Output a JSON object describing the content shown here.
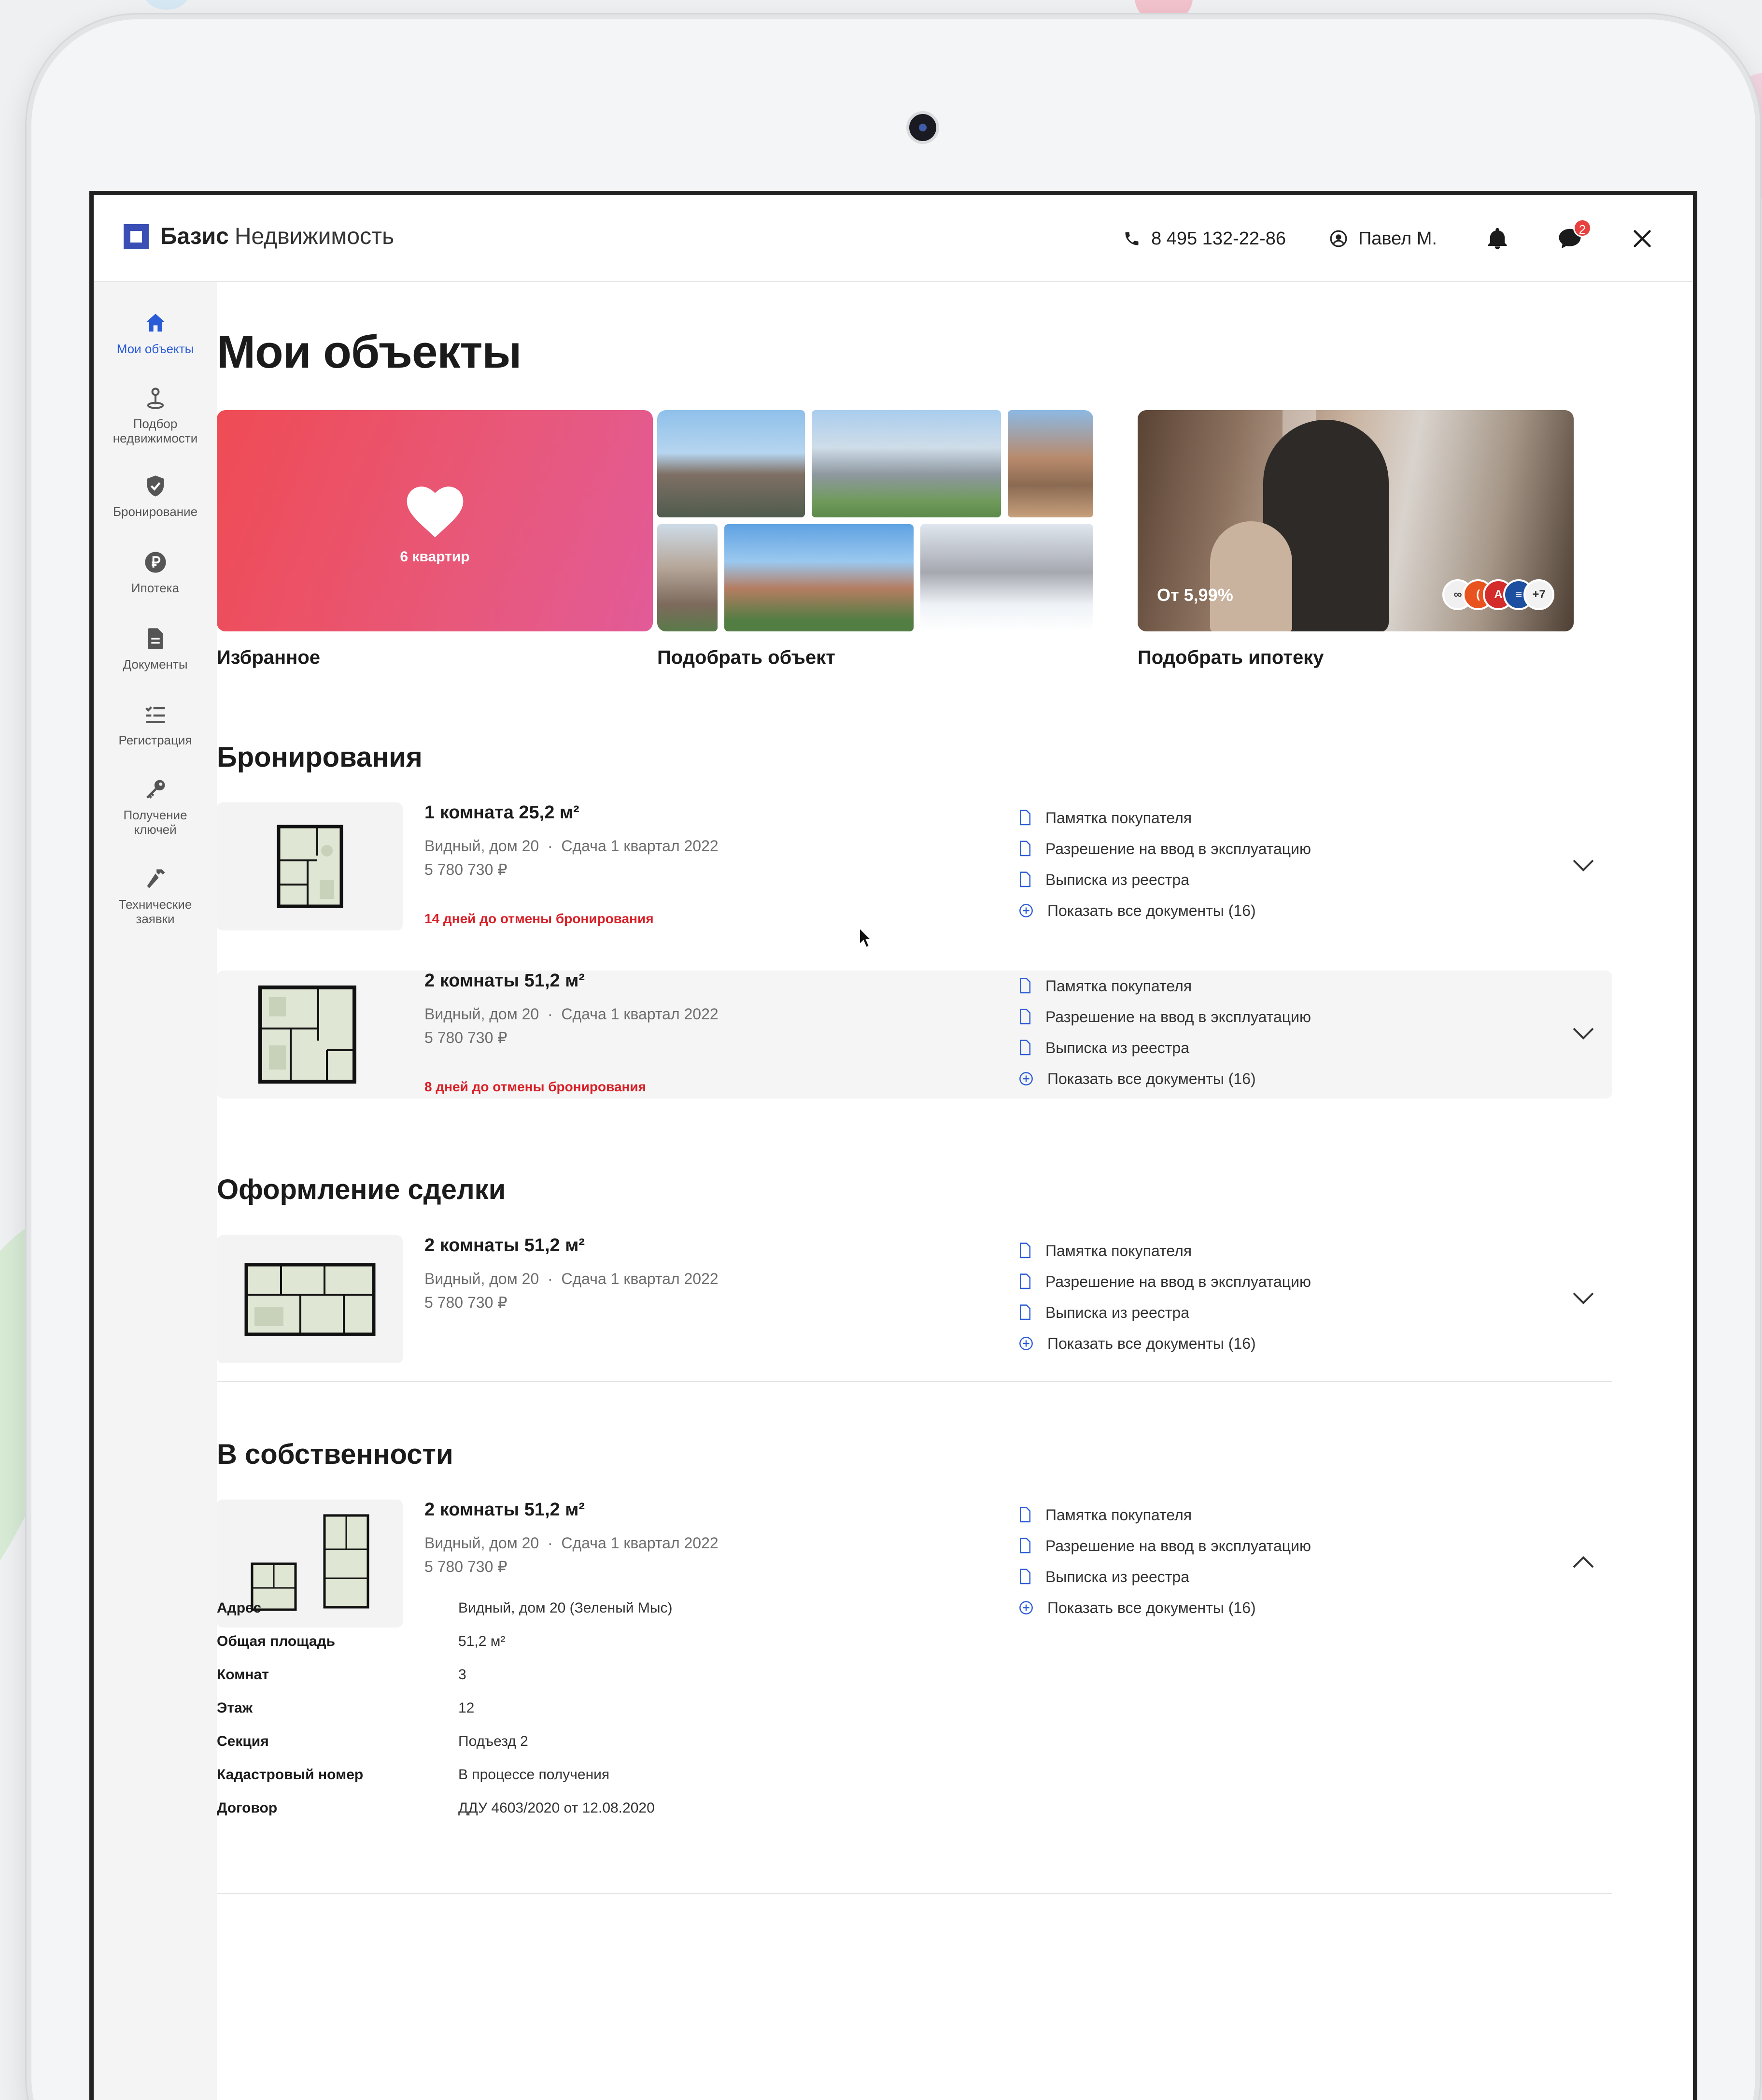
{
  "brand": {
    "name": "Базис",
    "suffix": "Недвижимость"
  },
  "topbar": {
    "phone": "8 495 132-22-86",
    "user": "Павел М.",
    "messages_badge": "2"
  },
  "sidebar": {
    "items": [
      {
        "label": "Мои объекты",
        "icon": "home-icon",
        "active": true
      },
      {
        "label": "Подбор\nнедвижимости",
        "icon": "location-pin-icon"
      },
      {
        "label": "Бронирование",
        "icon": "shield-check-icon"
      },
      {
        "label": "Ипотека",
        "icon": "ruble-coin-icon"
      },
      {
        "label": "Документы",
        "icon": "document-icon"
      },
      {
        "label": "Регистрация",
        "icon": "checklist-icon"
      },
      {
        "label": "Получение\nключей",
        "icon": "key-icon"
      },
      {
        "label": "Технические\nзаявки",
        "icon": "hammer-icon"
      }
    ]
  },
  "page": {
    "title": "Мои объекты"
  },
  "cards": {
    "favorites": {
      "count_label": "6 квартир",
      "caption": "Избранное"
    },
    "objects": {
      "caption": "Подобрать объект"
    },
    "mortgage": {
      "rate": "От 5,99%",
      "more_banks": "+7",
      "caption": "Подобрать ипотеку"
    }
  },
  "doc_links": {
    "memo": "Памятка покупателя",
    "permit": "Разрешение на ввод в эксплуатацию",
    "extract": "Выписка из реестра",
    "show_all": "Показать все документы (16)"
  },
  "sections": {
    "bookings": {
      "title": "Бронирования",
      "items": [
        {
          "title": "1 комната 25,2 м²",
          "address": "Видный, дом 20",
          "delivery": "Сдача 1 квартал 2022",
          "price": "5 780 730 ₽",
          "warning": "14 дней до отмены бронирования"
        },
        {
          "title": "2 комнаты 51,2 м²",
          "address": "Видный, дом 20",
          "delivery": "Сдача 1 квартал 2022",
          "price": "5 780 730 ₽",
          "warning": "8 дней до отмены бронирования"
        }
      ]
    },
    "deal": {
      "title": "Оформление сделки",
      "items": [
        {
          "title": "2 комнаты 51,2 м²",
          "address": "Видный, дом 20",
          "delivery": "Сдача 1 квартал 2022",
          "price": "5 780 730 ₽"
        }
      ]
    },
    "owned": {
      "title": "В собственности",
      "items": [
        {
          "title": "2 комнаты 51,2 м²",
          "address": "Видный, дом 20",
          "delivery": "Сдача 1 квартал 2022",
          "price": "5 780 730 ₽"
        }
      ],
      "details": [
        {
          "key": "Адрес",
          "value": "Видный, дом 20 (Зеленый Мыс)"
        },
        {
          "key": "Общая площадь",
          "value": "51,2 м²"
        },
        {
          "key": "Комнат",
          "value": "3"
        },
        {
          "key": "Этаж",
          "value": "12"
        },
        {
          "key": "Секция",
          "value": "Подъезд 2"
        },
        {
          "key": "Кадастровый номер",
          "value": "В процессе получения"
        },
        {
          "key": "Договор",
          "value": "ДДУ 4603/2020 от 12.08.2020"
        }
      ]
    }
  },
  "colors": {
    "accent": "#2a5bd7",
    "warning": "#d81f26",
    "brand": "#3a4fb5"
  }
}
